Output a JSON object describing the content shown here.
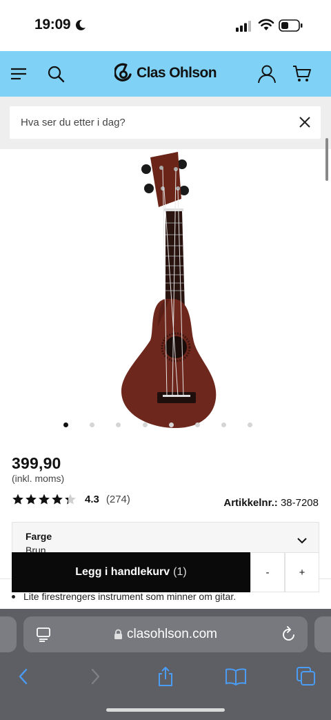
{
  "status_bar": {
    "time": "19:09"
  },
  "header": {
    "logo_text": "Clas Ohlson",
    "icons": [
      "menu-icon",
      "search-icon",
      "user-icon",
      "cart-icon"
    ],
    "background_color": "#7fd2f5"
  },
  "search": {
    "placeholder": "Hva ser du etter i dag?"
  },
  "gallery": {
    "total_images": 8,
    "active_index": 0
  },
  "product": {
    "price": "399,90",
    "price_note": "(inkl. moms)",
    "rating_value": "4.3",
    "rating_count": "(274)",
    "rating_stars": 4.3,
    "article_label": "Artikkelnr.:",
    "article_number": "38-7208"
  },
  "variant": {
    "label": "Farge",
    "value": "Brun"
  },
  "cart_bar": {
    "add_label": "Legg i handlekurv",
    "count": "(1)",
    "minus": "-",
    "plus": "+"
  },
  "features": [
    "Lite firestrengers instrument som minner om gitar."
  ],
  "safari": {
    "url": "clasohlson.com"
  }
}
